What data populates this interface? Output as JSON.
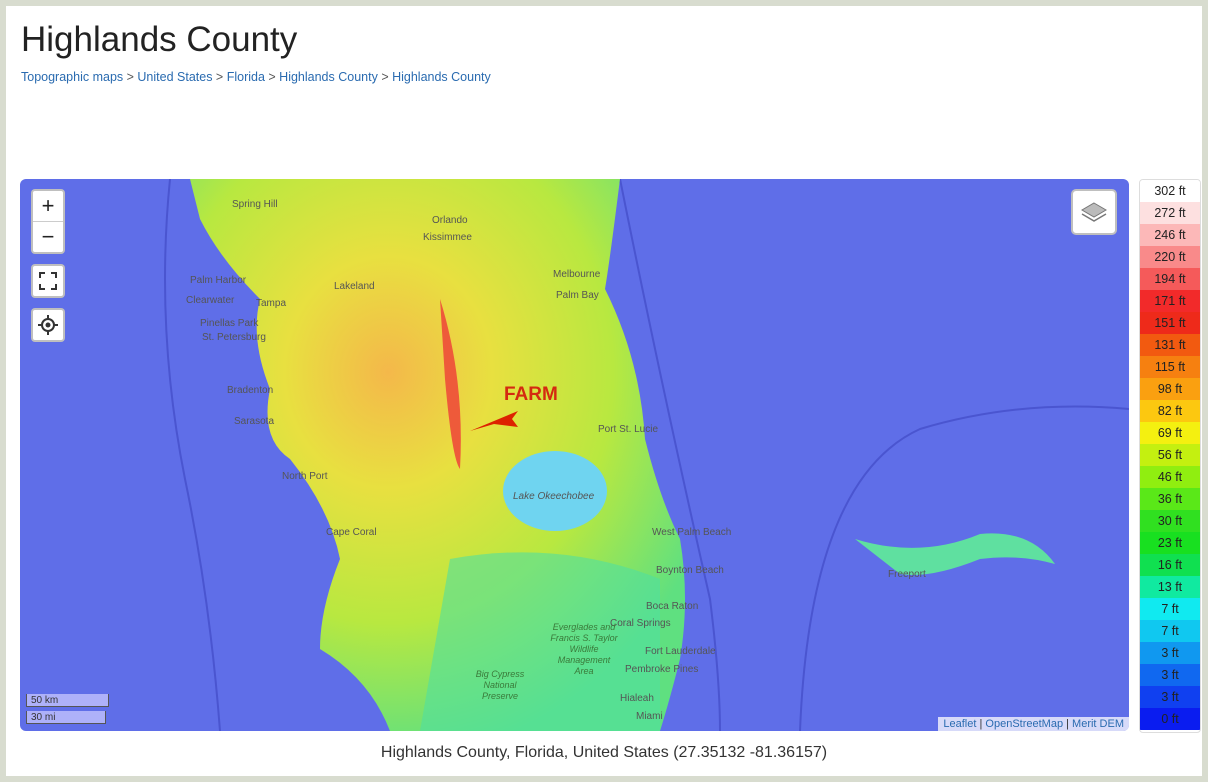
{
  "title": "Highlands County",
  "breadcrumbs": [
    "Topographic maps",
    "United States",
    "Florida",
    "Highlands County",
    "Highlands County"
  ],
  "map": {
    "zoom_in": "+",
    "zoom_out": "−",
    "annotation": "FARM",
    "place_labels": [
      "Orlando",
      "Spring Hill",
      "Kissimmee",
      "Palm Harbor",
      "Clearwater",
      "Tampa",
      "Lakeland",
      "Pinellas Park",
      "St. Petersburg",
      "Melbourne",
      "Palm Bay",
      "Bradenton",
      "Sarasota",
      "Port St. Lucie",
      "North Port",
      "Lake Okeechobee",
      "Cape Coral",
      "West Palm Beach",
      "Boynton Beach",
      "Boca Raton",
      "Coral Springs",
      "Fort Lauderdale",
      "Pembroke Pines",
      "Hialeah",
      "Miami",
      "Everglades and Francis S. Taylor Wildlife Management Area",
      "Big Cypress National Preserve",
      "Freeport"
    ],
    "scale_km": "50 km",
    "scale_mi": "30 mi",
    "attribution": [
      "Leaflet",
      "OpenStreetMap",
      "Merit DEM"
    ]
  },
  "legend": [
    {
      "label": "302 ft",
      "color": "#ffffff"
    },
    {
      "label": "272 ft",
      "color": "#fde0e0"
    },
    {
      "label": "246 ft",
      "color": "#fcb8b8"
    },
    {
      "label": "220 ft",
      "color": "#f98a8a"
    },
    {
      "label": "194 ft",
      "color": "#f55a5a"
    },
    {
      "label": "171 ft",
      "color": "#f22a2a"
    },
    {
      "label": "151 ft",
      "color": "#ee2a1a"
    },
    {
      "label": "131 ft",
      "color": "#f25a10"
    },
    {
      "label": "115 ft",
      "color": "#f68010"
    },
    {
      "label": "98 ft",
      "color": "#faa010"
    },
    {
      "label": "82 ft",
      "color": "#fcc810"
    },
    {
      "label": "69 ft",
      "color": "#f4f010"
    },
    {
      "label": "56 ft",
      "color": "#c4f010"
    },
    {
      "label": "46 ft",
      "color": "#90ee10"
    },
    {
      "label": "36 ft",
      "color": "#5ae818"
    },
    {
      "label": "30 ft",
      "color": "#30e020"
    },
    {
      "label": "23 ft",
      "color": "#18e020"
    },
    {
      "label": "16 ft",
      "color": "#10e050"
    },
    {
      "label": "13 ft",
      "color": "#10eaa0"
    },
    {
      "label": "7 ft",
      "color": "#10eaf0"
    },
    {
      "label": "7 ft",
      "color": "#10c8f0"
    },
    {
      "label": "3 ft",
      "color": "#1098f0"
    },
    {
      "label": "3 ft",
      "color": "#1068f0"
    },
    {
      "label": "3 ft",
      "color": "#1040f0"
    },
    {
      "label": "0 ft",
      "color": "#0a1cf0"
    }
  ],
  "caption": "Highlands County, Florida, United States (27.35132 -81.36157)"
}
